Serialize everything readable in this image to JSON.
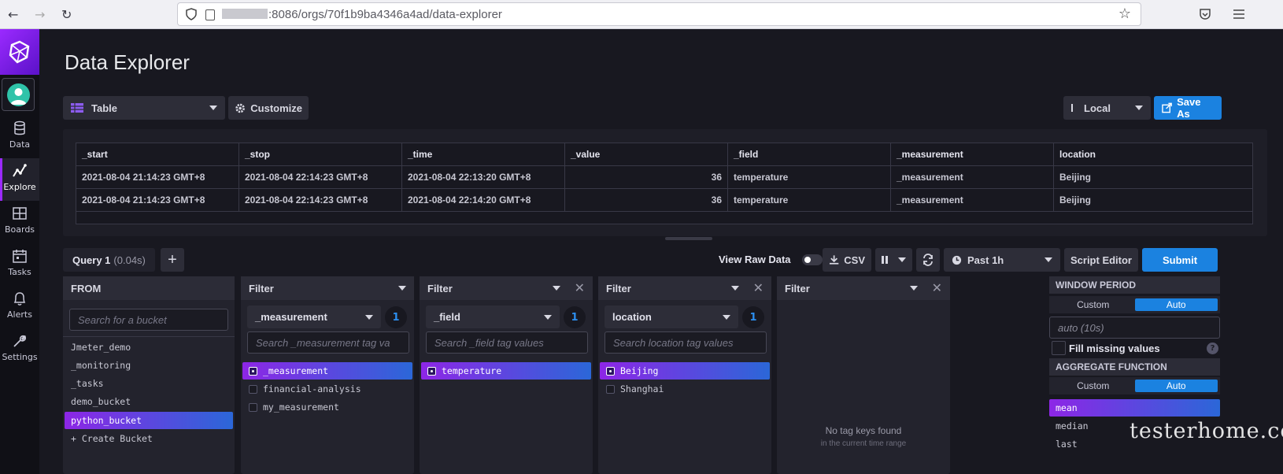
{
  "browser": {
    "url_suffix": ":8086/orgs/70f1b9ba4346a4ad/data-explorer"
  },
  "sidebar": {
    "items": [
      {
        "label": "Data",
        "icon": "database-icon"
      },
      {
        "label": "Explore",
        "icon": "graph-icon"
      },
      {
        "label": "Boards",
        "icon": "dashboard-icon"
      },
      {
        "label": "Tasks",
        "icon": "calendar-icon"
      },
      {
        "label": "Alerts",
        "icon": "bell-icon"
      },
      {
        "label": "Settings",
        "icon": "wrench-icon"
      }
    ]
  },
  "header": {
    "title": "Data Explorer",
    "view_type": "Table",
    "customize": "Customize",
    "timezone": "Local",
    "save_as": "Save As"
  },
  "table": {
    "columns": [
      "_start",
      "_stop",
      "_time",
      "_value",
      "_field",
      "_measurement",
      "location"
    ],
    "rows": [
      [
        "2021-08-04 21:14:23 GMT+8",
        "2021-08-04 22:14:23 GMT+8",
        "2021-08-04 22:13:20 GMT+8",
        "36",
        "temperature",
        "_measurement",
        "Beijing"
      ],
      [
        "2021-08-04 21:14:23 GMT+8",
        "2021-08-04 22:14:23 GMT+8",
        "2021-08-04 22:14:20 GMT+8",
        "36",
        "temperature",
        "_measurement",
        "Beijing"
      ]
    ]
  },
  "query_bar": {
    "tab_label": "Query 1",
    "tab_time": "(0.04s)",
    "add": "+",
    "view_raw": "View Raw Data",
    "csv": "CSV",
    "range": "Past 1h",
    "script_editor": "Script Editor",
    "submit": "Submit"
  },
  "from": {
    "title": "FROM",
    "search_placeholder": "Search for a bucket",
    "buckets": [
      "Jmeter_demo",
      "_monitoring",
      "_tasks",
      "demo_bucket",
      "python_bucket"
    ],
    "selected_bucket": "python_bucket",
    "create": "+ Create Bucket"
  },
  "filters": [
    {
      "title": "Filter",
      "key": "_measurement",
      "count": "1",
      "search_placeholder": "Search _measurement tag va",
      "values": [
        "_measurement",
        "financial-analysis",
        "my_measurement"
      ],
      "selected": "_measurement"
    },
    {
      "title": "Filter",
      "key": "_field",
      "count": "1",
      "search_placeholder": "Search _field tag values",
      "values": [
        "temperature"
      ],
      "selected": "temperature"
    },
    {
      "title": "Filter",
      "key": "location",
      "count": "1",
      "search_placeholder": "Search location tag values",
      "values": [
        "Beijing",
        "Shanghai"
      ],
      "selected": "Beijing"
    },
    {
      "title": "Filter",
      "empty_main": "No tag keys found",
      "empty_sub": "in the current time range"
    }
  ],
  "window_period": {
    "title": "WINDOW PERIOD",
    "custom": "Custom",
    "auto": "Auto",
    "value": "auto (10s)",
    "fill_missing": "Fill missing values",
    "help": "?"
  },
  "aggregate": {
    "title": "AGGREGATE FUNCTION",
    "custom": "Custom",
    "auto": "Auto",
    "functions": [
      "mean",
      "median",
      "last"
    ],
    "selected": "mean"
  },
  "watermark": "testerhome.com",
  "colors": {
    "accent_purple": "#9b2aff",
    "accent_blue": "#1b82e0",
    "bg": "#181820"
  }
}
